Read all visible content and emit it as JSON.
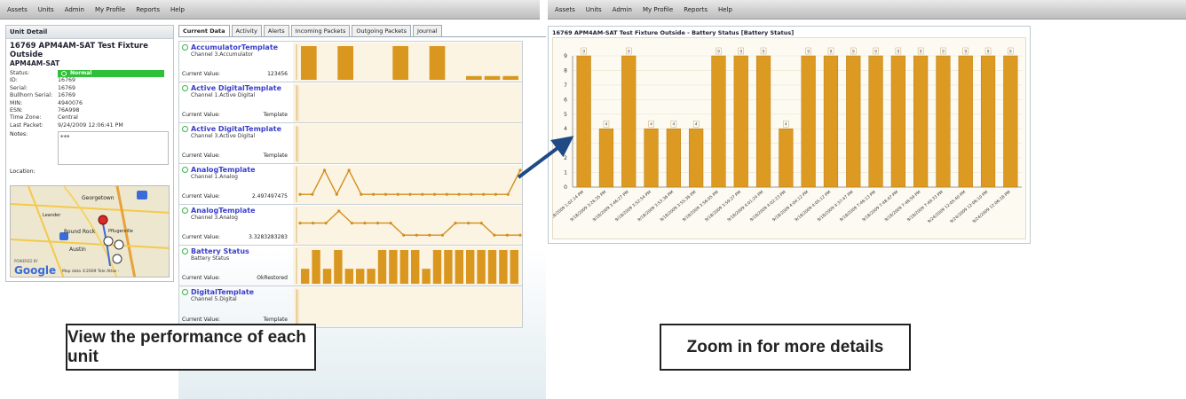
{
  "left_nav": [
    "Assets",
    "Units",
    "Admin",
    "My Profile",
    "Reports",
    "Help"
  ],
  "right_nav": [
    "Assets",
    "Units",
    "Admin",
    "My Profile",
    "Reports",
    "Help"
  ],
  "unit_detail": {
    "title": "Unit Detail",
    "name": "16769 APM4AM-SAT Test Fixture Outside",
    "model": "APM4AM-SAT",
    "fields": [
      {
        "k": "Status:",
        "v": "Normal"
      },
      {
        "k": "ID:",
        "v": "16769"
      },
      {
        "k": "Serial:",
        "v": "16769"
      },
      {
        "k": "Bullhorn Serial:",
        "v": "16769"
      },
      {
        "k": "MIN:",
        "v": "4940076"
      },
      {
        "k": "ESN:",
        "v": "76A998"
      },
      {
        "k": "Time Zone:",
        "v": "Central"
      },
      {
        "k": "Last Packet:",
        "v": "9/24/2009 12:06:41 PM"
      }
    ],
    "notes_label": "Notes:",
    "notes_value": "***",
    "location_label": "Location:",
    "map_labels": {
      "georgetown": "Georgetown",
      "round_rock": "Round Rock",
      "pflugerville": "Pflugerville",
      "austin": "Austin",
      "leander": "Leander",
      "google": "Google",
      "powered_by": "POWERED BY",
      "attribution": "Map data ©2009 Tele Atlas -"
    }
  },
  "tabs": [
    "Current Data",
    "Activity",
    "Alerts",
    "Incoming Packets",
    "Outgoing Packets",
    "Journal"
  ],
  "metrics": [
    {
      "name": "AccumulatorTemplate",
      "channel": "Channel 3.Accumulator",
      "cv_label": "Current Value:",
      "cv": "123456",
      "color": "#2fbf38"
    },
    {
      "name": "Active DigitalTemplate",
      "channel": "Channel 1.Active Digital",
      "cv_label": "Current Value:",
      "cv": "Template",
      "color": "#f0a020"
    },
    {
      "name": "Active DigitalTemplate",
      "channel": "Channel 3.Active Digital",
      "cv_label": "Current Value:",
      "cv": "Template",
      "color": "#f0a020"
    },
    {
      "name": "AnalogTemplate",
      "channel": "Channel 1.Analog",
      "cv_label": "Current Value:",
      "cv": "2.497497475",
      "color": "#f0a020"
    },
    {
      "name": "AnalogTemplate",
      "channel": "Channel 3.Analog",
      "cv_label": "Current Value:",
      "cv": "3.3283283283",
      "color": "#f0a020"
    },
    {
      "name": "Battery Status",
      "channel": "Battery Status",
      "cv_label": "Current Value:",
      "cv": "OkRestored",
      "color": "#e05a10"
    },
    {
      "name": "DigitalTemplate",
      "channel": "Channel 5.Digital",
      "cv_label": "Current Value:",
      "cv": "Template",
      "color": "#f0a020"
    }
  ],
  "callouts": {
    "left": "View the performance of each unit",
    "right": "Zoom in for more details"
  },
  "chart_data": {
    "type": "bar",
    "title": "16769 APM4AM-SAT Test Fixture Outside - Battery Status [Battery Status]",
    "xlabel": "",
    "ylabel": "",
    "ylim": [
      0,
      9
    ],
    "yticks": [
      0,
      1,
      2,
      3,
      4,
      5,
      6,
      7,
      8,
      9
    ],
    "grid": true,
    "categories": [
      "9/18/2009 1:02:14 PM",
      "9/18/2009 3:26:35 PM",
      "9/18/2009 3:46:27 PM",
      "9/18/2009 3:52:54 PM",
      "9/18/2009 3:53:36 PM",
      "9/18/2009 3:55:36 PM",
      "9/18/2009 3:56:05 PM",
      "9/18/2009 3:59:27 PM",
      "9/18/2009 4:01:24 PM",
      "9/18/2009 4:02:23 PM",
      "9/18/2009 4:04:12 PM",
      "9/18/2009 4:05:12 PM",
      "9/18/2009 4:37:47 PM",
      "9/18/2009 7:46:13 PM",
      "9/18/2009 7:48:47 PM",
      "9/18/2009 7:48:59 PM",
      "9/18/2009 7:49:33 PM",
      "9/24/2009 12:05:40 PM",
      "9/24/2009 12:06:10 PM",
      "9/24/2009 12:06:28 PM"
    ],
    "values": [
      9,
      4,
      9,
      4,
      4,
      4,
      9,
      9,
      9,
      4,
      9,
      9,
      9,
      9,
      9,
      9,
      9,
      9,
      9,
      9
    ],
    "data_labels": [
      "9",
      "4",
      "9",
      "4",
      "4",
      "4",
      "9",
      "9",
      "9",
      "4",
      "9",
      "9",
      "9",
      "9",
      "9",
      "9",
      "9",
      "9",
      "9",
      "9"
    ]
  },
  "sparklines": {
    "accumulator": [
      9,
      0,
      9,
      0,
      0,
      9,
      0,
      9,
      0,
      1,
      1,
      1
    ],
    "active1": [],
    "active3": [],
    "analog1": [
      1,
      1,
      5,
      1,
      5,
      1,
      1,
      1,
      1,
      1,
      1,
      1,
      1,
      1,
      1,
      1,
      1,
      1,
      5
    ],
    "analog3": [
      3,
      3,
      3,
      5,
      3,
      3,
      3,
      3,
      1,
      1,
      1,
      1,
      3,
      3,
      3,
      1,
      1,
      1
    ],
    "battery": [
      4,
      9,
      4,
      9,
      4,
      4,
      4,
      9,
      9,
      9,
      9,
      4,
      9,
      9,
      9,
      9,
      9,
      9,
      9,
      9
    ],
    "digital": []
  }
}
